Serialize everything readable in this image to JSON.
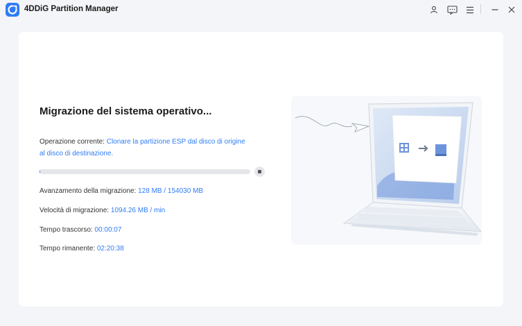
{
  "app": {
    "title": "4DDiG Partition Manager",
    "accent": "#2f7cf6"
  },
  "titlebar": {
    "icons": [
      "user-icon",
      "feedback-icon",
      "menu-icon",
      "minimize-icon",
      "close-icon"
    ]
  },
  "migration": {
    "heading": "Migrazione del sistema operativo...",
    "current_op_label": "Operazione corrente: ",
    "current_op_value": "Clonare la partizione ESP dal disco di origine al disco di destinazione.",
    "progress_fraction": 0.0008,
    "stats": [
      {
        "label": "Avanzamento della migrazione: ",
        "value": "128 MB / 154030 MB"
      },
      {
        "label": "Velocità di migrazione: ",
        "value": "1094.26 MB / min"
      },
      {
        "label": "Tempo trascorso: ",
        "value": "00:00:07"
      },
      {
        "label": "Tempo rimanente: ",
        "value": "02:20:38"
      }
    ]
  }
}
